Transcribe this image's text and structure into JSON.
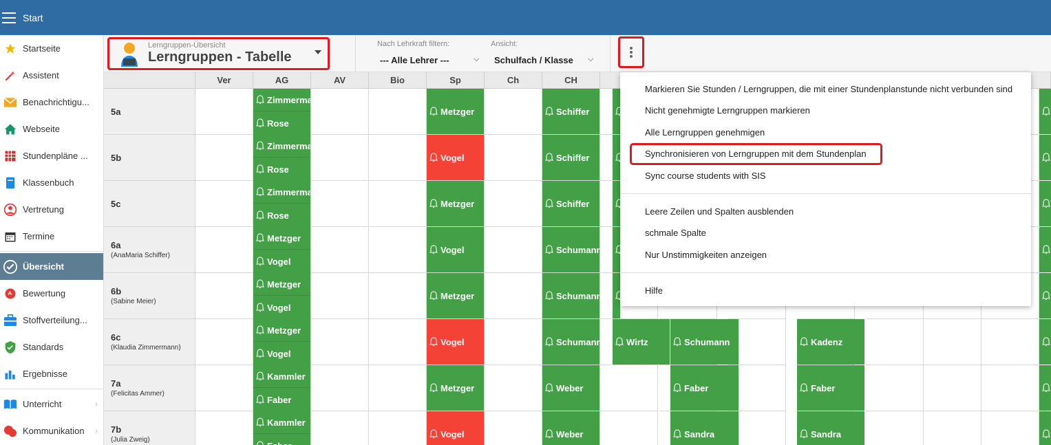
{
  "topbar": {
    "title": "Start"
  },
  "sidebar": {
    "items": [
      {
        "label": "Startseite",
        "icon": "star-icon"
      },
      {
        "label": "Assistent",
        "icon": "magic-wand-icon"
      },
      {
        "label": "Benachrichtigu...",
        "icon": "envelope-icon"
      },
      {
        "label": "Webseite",
        "icon": "home-icon"
      },
      {
        "label": "Stundenpläne ...",
        "icon": "calendar-grid-icon"
      },
      {
        "label": "Klassenbuch",
        "icon": "book-icon"
      },
      {
        "label": "Vertretung",
        "icon": "person-swap-icon"
      },
      {
        "label": "Termine",
        "icon": "calendar-icon"
      },
      {
        "label": "Übersicht",
        "icon": "check-circle-icon",
        "active": true
      },
      {
        "label": "Bewertung",
        "icon": "grade-icon"
      },
      {
        "label": "Stoffverteilung...",
        "icon": "briefcase-icon"
      },
      {
        "label": "Standards",
        "icon": "shield-check-icon"
      },
      {
        "label": "Ergebnisse",
        "icon": "bar-chart-icon"
      },
      {
        "label": "Unterricht",
        "icon": "open-book-icon"
      },
      {
        "label": "Kommunikation",
        "icon": "chat-icon"
      }
    ]
  },
  "toolbar": {
    "selector_small": "Lerngruppen-Übersicht",
    "selector_big": "Lerngruppen - Tabelle",
    "filter_teacher_label": "Nach Lehrkraft filtern:",
    "filter_teacher_value": "--- Alle Lehrer ---",
    "view_label": "Ansicht:",
    "view_value": "Schulfach / Klasse"
  },
  "grid": {
    "columns": [
      "Ver",
      "AG",
      "AV",
      "Bio",
      "Sp",
      "Ch",
      "CH"
    ],
    "rows": [
      {
        "class": "5a",
        "teacher": ""
      },
      {
        "class": "5b",
        "teacher": ""
      },
      {
        "class": "5c",
        "teacher": ""
      },
      {
        "class": "6a",
        "teacher": "(AnaMaria Schiffer)"
      },
      {
        "class": "6b",
        "teacher": "(Sabine Meier)"
      },
      {
        "class": "6c",
        "teacher": "(Klaudia Zimmermann)"
      },
      {
        "class": "7a",
        "teacher": "(Felicitas Ammer)"
      },
      {
        "class": "7b",
        "teacher": "(Julia Zweig)"
      }
    ],
    "chips": {
      "ag": [
        [
          "Zimmermann",
          "Rose"
        ],
        [
          "Zimmermann",
          "Rose"
        ],
        [
          "Zimmermann",
          "Rose"
        ],
        [
          "Metzger",
          "Vogel"
        ],
        [
          "Metzger",
          "Vogel"
        ],
        [
          "Metzger",
          "Vogel"
        ],
        [
          "Kammler",
          "Faber"
        ],
        [
          "Kammler",
          "Faber"
        ]
      ],
      "sp": [
        {
          "name": "Metzger",
          "status": "green"
        },
        {
          "name": "Vogel",
          "status": "red"
        },
        {
          "name": "Metzger",
          "status": "green"
        },
        {
          "name": "Vogel",
          "status": "green"
        },
        {
          "name": "Metzger",
          "status": "green"
        },
        {
          "name": "Vogel",
          "status": "red"
        },
        {
          "name": "Metzger",
          "status": "green"
        },
        {
          "name": "Vogel",
          "status": "red"
        }
      ],
      "ch": [
        "Schiffer",
        "Schiffer",
        "Schiffer",
        "Schumann",
        "Schumann",
        "Schumann",
        "Weber",
        "Weber"
      ],
      "extra_6c": [
        "Wirtz",
        "Schumann",
        "Kadenz"
      ],
      "extra_7a": [
        "Faber",
        "Faber"
      ],
      "extra_7b": [
        "Sandra",
        "Sandra"
      ]
    }
  },
  "menu": {
    "items": [
      "Markieren Sie Stunden / Lerngruppen, die mit einer Stundenplanstunde nicht verbunden sind",
      "Nicht genehmigte Lerngruppen markieren",
      "Alle Lerngruppen genehmigen",
      "Synchronisieren von Lerngruppen mit dem Stundenplan",
      "Sync course students with SIS",
      "Leere Zeilen und Spalten ausblenden",
      "schmale Spalte",
      "Nur Unstimmigkeiten anzeigen",
      "Hilfe"
    ]
  },
  "colors": {
    "topbar": "#2f6ca3",
    "green": "#43a047",
    "red": "#f44336",
    "highlight": "#e0191e"
  }
}
